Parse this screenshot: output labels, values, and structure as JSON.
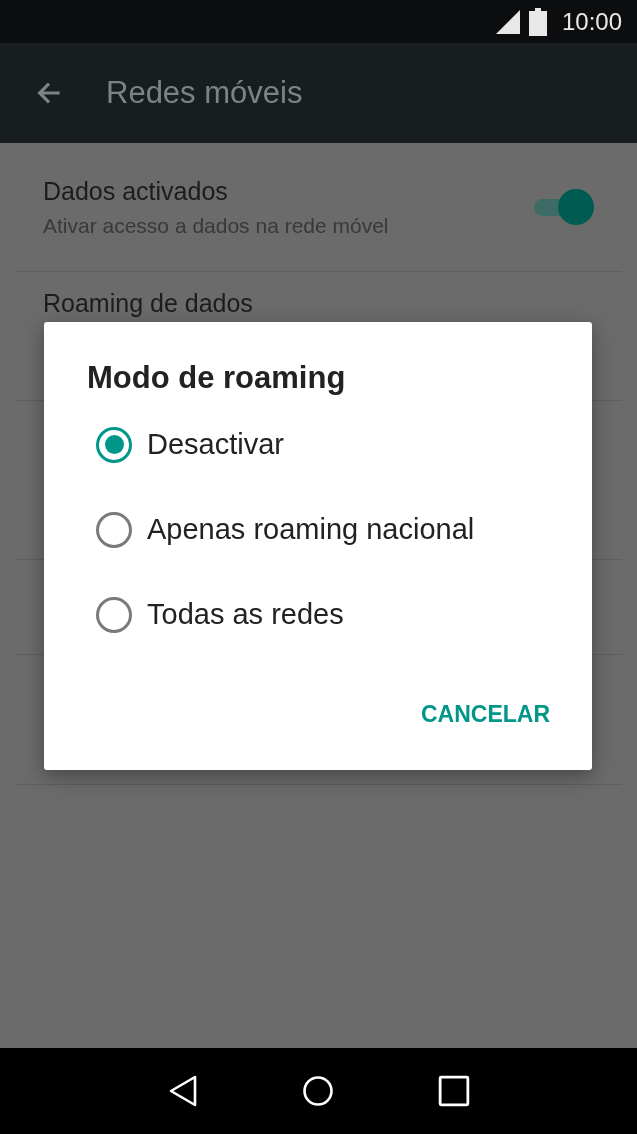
{
  "status_bar": {
    "time": "10:00"
  },
  "app_bar": {
    "title": "Redes móveis"
  },
  "settings": [
    {
      "title": "Dados activados",
      "subtitle": "Ativar acesso a dados na rede móvel",
      "kind": "toggle",
      "on": true
    },
    {
      "title": "Roaming de dados",
      "kind": "plain"
    }
  ],
  "dialog": {
    "title": "Modo de roaming",
    "options": [
      {
        "label": "Desactivar",
        "selected": true
      },
      {
        "label": "Apenas roaming nacional",
        "selected": false
      },
      {
        "label": "Todas as redes",
        "selected": false
      }
    ],
    "buttons": [
      "CANCELAR"
    ]
  }
}
